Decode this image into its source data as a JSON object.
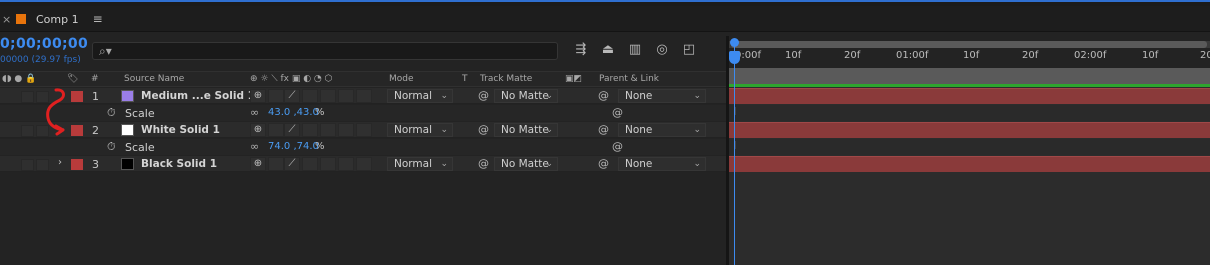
{
  "tab": {
    "close_glyph": "×",
    "comp_color": "#e8740c",
    "name": "Comp 1",
    "menu_glyph": "≡"
  },
  "timecode": {
    "value": "0;00;00;00",
    "fps": "00000 (29.97 fps)"
  },
  "search": {
    "icon": "⌕▾",
    "placeholder": ""
  },
  "toolbar": {
    "icons": [
      "composition-flowchart-icon",
      "draft-3d-icon",
      "frame-blending-icon",
      "motion-blur-icon",
      "graph-editor-icon"
    ]
  },
  "columns": {
    "num": "#",
    "source_name": "Source Name",
    "switches": "⊕ ☼ ⟍ fx ▣ ◐ ◔ ⬡",
    "mode": "Mode",
    "t": "T",
    "track_matte": "Track Matte",
    "parent_link": "Parent & Link"
  },
  "layers": [
    {
      "num": "1",
      "name": "Medium ...e Solid 1",
      "color": "#9a7ee8",
      "mode": "Normal",
      "matte": "No Matte",
      "parent": "None",
      "prop": {
        "name": "Scale",
        "value": "43.0 ,43.0",
        "unit": "%"
      }
    },
    {
      "num": "2",
      "name": "White Solid 1",
      "color": "#ffffff",
      "mode": "Normal",
      "matte": "No Matte",
      "parent": "None",
      "twirl": "⌄",
      "prop": {
        "name": "Scale",
        "value": "74.0 ,74.0",
        "unit": "%"
      }
    },
    {
      "num": "3",
      "name": "Black Solid 1",
      "color": "#000000",
      "mode": "Normal",
      "matte": "No Matte",
      "parent": "None",
      "twirl": "›"
    }
  ],
  "timeline": {
    "ticks": [
      "0:00f",
      "10f",
      "20f",
      "01:00f",
      "10f",
      "20f",
      "02:00f",
      "10f",
      "20f"
    ],
    "bar_color": "#8a3a3a",
    "keyframe_glyph": "I"
  },
  "colors": {
    "accent": "#3d8bf0",
    "label_red": "#b83b3b",
    "annotation": "#e02020"
  }
}
